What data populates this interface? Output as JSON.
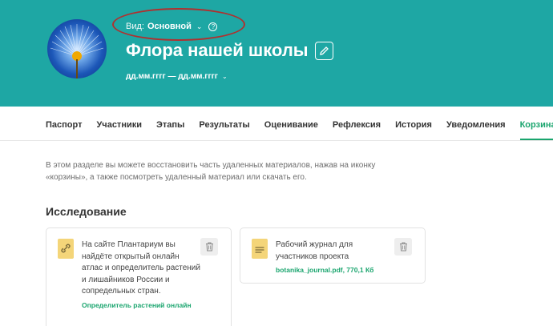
{
  "header": {
    "view_label": "Вид:",
    "view_value": "Основной",
    "view_chevron": "⌄",
    "help_glyph": "?",
    "title": "Флора нашей школы",
    "dates": "дд.мм.гггг — дд.мм.гггг",
    "dates_chevron": "⌄",
    "bg_color": "#1ea7a4",
    "highlight_color": "#b0302f"
  },
  "tabs": [
    {
      "label": "Паспорт"
    },
    {
      "label": "Участники"
    },
    {
      "label": "Этапы"
    },
    {
      "label": "Результаты"
    },
    {
      "label": "Оценивание"
    },
    {
      "label": "Рефлексия"
    },
    {
      "label": "История"
    },
    {
      "label": "Уведомления"
    },
    {
      "label": "Корзина",
      "active": true
    }
  ],
  "accent_color": "#1aa56e",
  "info_text": "В этом разделе вы можете восстановить часть удаленных материалов, нажав на иконку «корзины», а также посмотреть удаленный материал или скачать его.",
  "section": {
    "title": "Исследование",
    "cards": [
      {
        "icon": "link-icon",
        "text": "На сайте Плантариум вы найдёте открытый онлайн атлас и определитель растений и лишайников России и сопредельных стран.",
        "link": "Определитель растений онлайн"
      },
      {
        "icon": "document-icon",
        "text": "Рабочий журнал для участников проекта",
        "link": "botanika_journal.pdf, 770,1 Кб"
      }
    ]
  }
}
